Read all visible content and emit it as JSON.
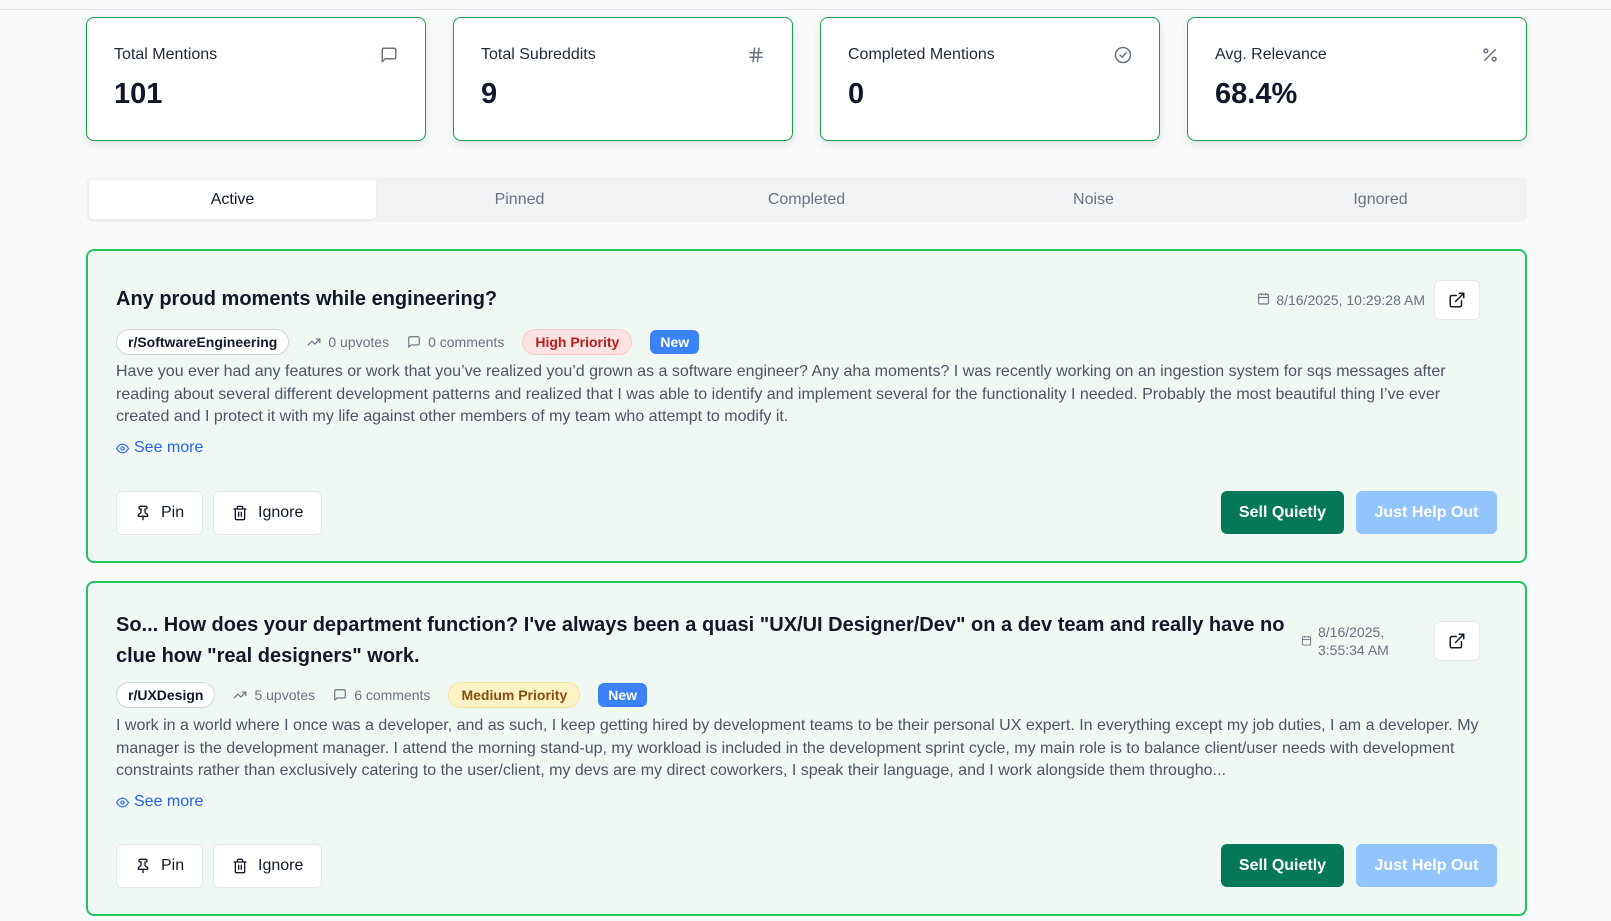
{
  "stats": [
    {
      "label": "Total Mentions",
      "value": "101",
      "icon": "message-square-icon"
    },
    {
      "label": "Total Subreddits",
      "value": "9",
      "icon": "hash-icon"
    },
    {
      "label": "Completed Mentions",
      "value": "0",
      "icon": "check-circle-icon"
    },
    {
      "label": "Avg. Relevance",
      "value": "68.4%",
      "icon": "percent-icon"
    }
  ],
  "tabs": [
    "Active",
    "Pinned",
    "Completed",
    "Noise",
    "Ignored"
  ],
  "active_tab": "Active",
  "posts": [
    {
      "title": "Any proud moments while engineering?",
      "date": "8/16/2025, 10:29:28 AM",
      "subreddit": "r/SoftwareEngineering",
      "upvotes": "0 upvotes",
      "comments": "0 comments",
      "priority": "High Priority",
      "badge": "New",
      "body": "Have you ever had any features or work that you’ve realized you’d grown as a software engineer? Any aha moments? I was recently working on an ingestion system for sqs messages after reading about several different development patterns and realized that I was able to identify and implement several for the functionality I needed. Probably the most beautiful thing I’ve ever created and I protect it with my life against other members of my team who attempt to modify it.",
      "see_more": "See more",
      "pin": "Pin",
      "ignore": "Ignore",
      "sell": "Sell Quietly",
      "help": "Just Help Out"
    },
    {
      "title": "So... How does your department function? I've always been a quasi \"UX/UI Designer/Dev\" on a dev team and really have no clue how \"real designers\" work.",
      "date_line1": "8/16/2025,",
      "date_line2": "3:55:34 AM",
      "subreddit": "r/UXDesign",
      "upvotes": "5 upvotes",
      "comments": "6 comments",
      "priority": "Medium Priority",
      "badge": "New",
      "body": "I work in a world where I once was a developer, and as such, I keep getting hired by development teams to be their personal UX expert. In everything except my job duties, I am a developer. My manager is the development manager. I attend the morning stand-up, my workload is included in the development sprint cycle, my main role is to balance client/user needs with development constraints rather than exclusively catering to the user/client, my devs are my direct coworkers, I speak their language, and I work alongside them througho...",
      "see_more": "See more",
      "pin": "Pin",
      "ignore": "Ignore",
      "sell": "Sell Quietly",
      "help": "Just Help Out"
    }
  ]
}
